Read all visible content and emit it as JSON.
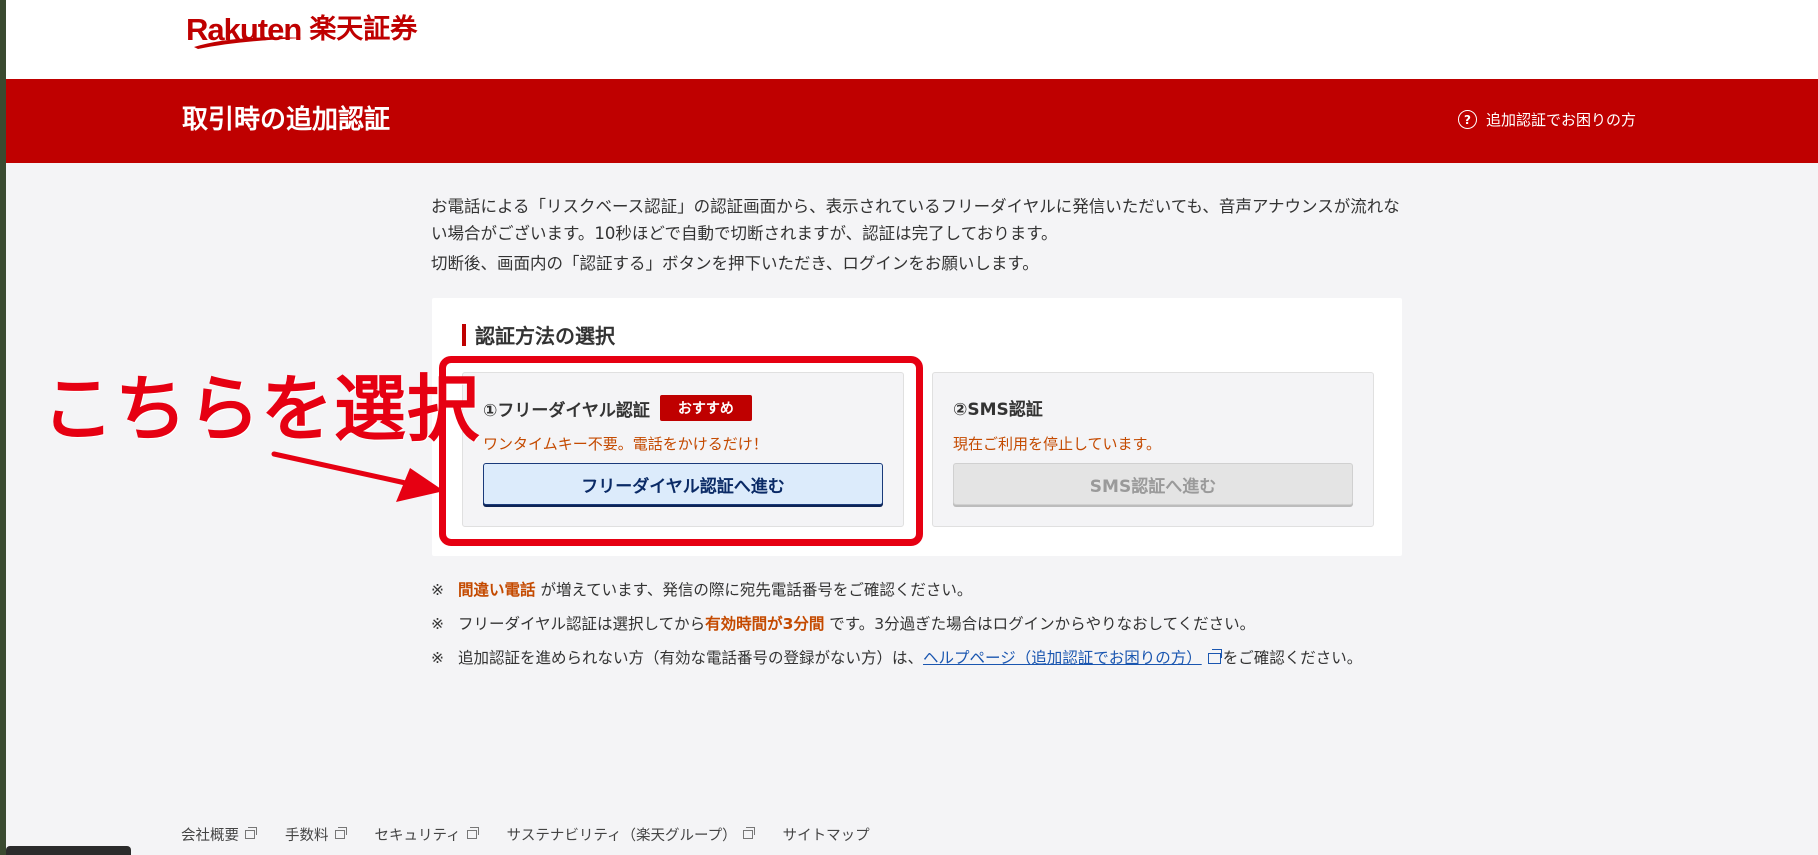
{
  "header": {
    "logo_en": "Rakuten",
    "logo_jp": "楽天証券"
  },
  "titlebar": {
    "title": "取引時の追加認証",
    "help_icon": "?",
    "help_link": "追加認証でお困りの方"
  },
  "intro": {
    "p1": "お電話による「リスクベース認証」の認証画面から、表示されているフリーダイヤルに発信いただいても、音声アナウンスが流れない場合がございます。10秒ほどで自動で切断されますが、認証は完了しております。",
    "p2": "切断後、画面内の「認証する」ボタンを押下いただき、ログインをお願いします。"
  },
  "selection": {
    "title": "認証方法の選択",
    "option1": {
      "title": "①フリーダイヤル認証",
      "badge": "おすすめ",
      "note": "ワンタイムキー不要。電話をかけるだけ！",
      "button": "フリーダイヤル認証へ進む"
    },
    "option2": {
      "title": "②SMS認証",
      "note": "現在ご利用を停止しています。",
      "button": "SMS認証へ進む"
    }
  },
  "notes": {
    "mark": "※",
    "n1_em": "間違い電話",
    "n1_rest": " が増えています、発信の際に宛先電話番号をご確認ください。",
    "n2_pre": "フリーダイヤル認証は選択してから",
    "n2_em": "有効時間が3分間",
    "n2_post": " です。3分過ぎた場合はログインからやりなおしてください。",
    "n3_pre": "追加認証を進められない方（有効な電話番号の登録がない方）は、",
    "n3_link": "ヘルプページ（追加認証でお困りの方）",
    "n3_post": "をご確認ください。"
  },
  "footer": {
    "links": [
      "会社概要",
      "手数料",
      "セキュリティ",
      "サステナビリティ（楽天グループ）",
      "サイトマップ"
    ]
  },
  "annotation": {
    "text": "こちらを選択"
  },
  "colors": {
    "brand_red": "#bf0000",
    "annotation_red": "#e60012",
    "warning_orange": "#c44a00",
    "link_blue": "#1a56b0"
  },
  "icons": [
    "help-circle-icon",
    "external-link-icon",
    "arrow-icon"
  ]
}
